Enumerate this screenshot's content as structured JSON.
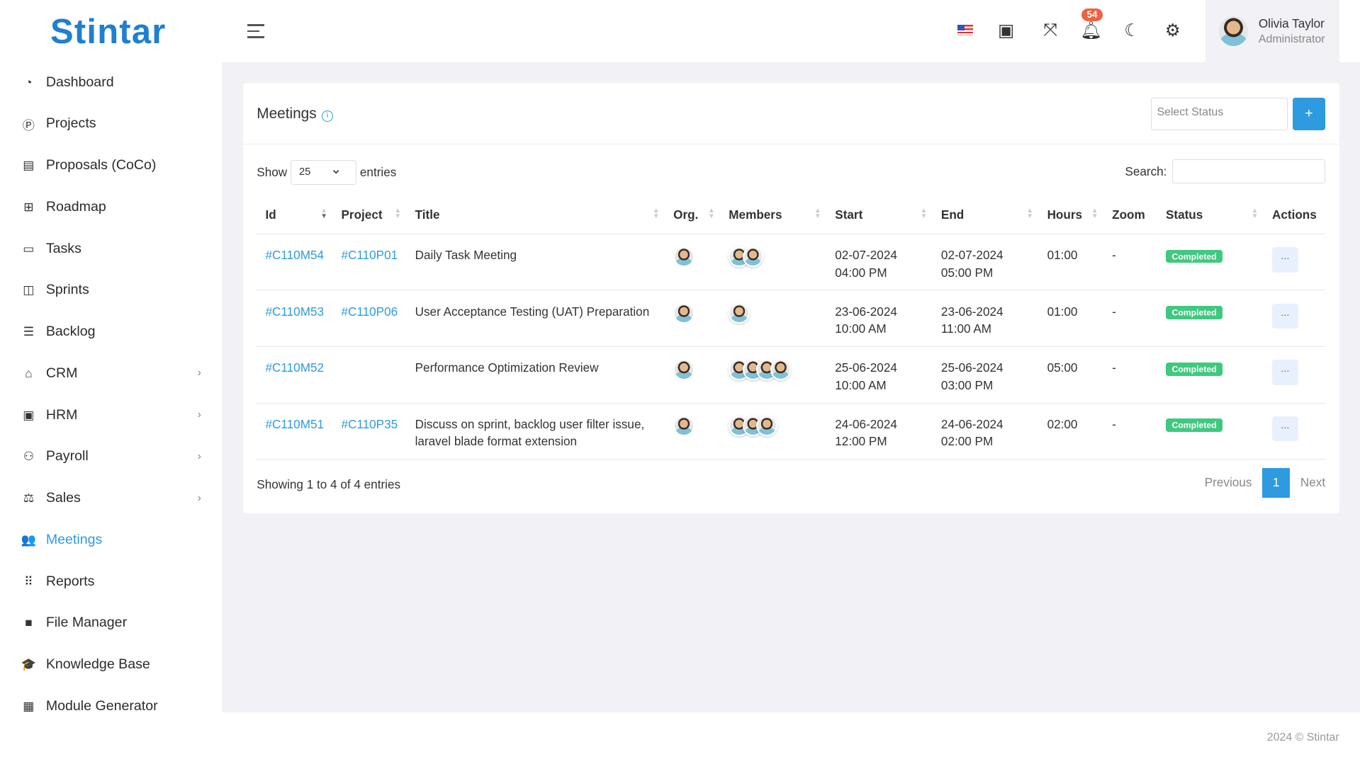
{
  "brand": {
    "logo": "Stintar"
  },
  "sidebar": {
    "items": [
      {
        "label": "Dashboard",
        "icon": "gauge-icon",
        "glyph": "◔"
      },
      {
        "label": "Projects",
        "icon": "p-circle-icon",
        "glyph": "Ⓟ"
      },
      {
        "label": "Proposals (CoCo)",
        "icon": "layout-icon",
        "glyph": "▤"
      },
      {
        "label": "Roadmap",
        "icon": "sitemap-icon",
        "glyph": "⊞"
      },
      {
        "label": "Tasks",
        "icon": "ticket-icon",
        "glyph": "▭"
      },
      {
        "label": "Sprints",
        "icon": "columns-icon",
        "glyph": "◫"
      },
      {
        "label": "Backlog",
        "icon": "list-check-icon",
        "glyph": "☰"
      },
      {
        "label": "CRM",
        "icon": "house-hand-icon",
        "glyph": "⌂",
        "chevron": true
      },
      {
        "label": "HRM",
        "icon": "id-badge-icon",
        "glyph": "▣",
        "chevron": true
      },
      {
        "label": "Payroll",
        "icon": "user-money-icon",
        "glyph": "⚇",
        "chevron": true
      },
      {
        "label": "Sales",
        "icon": "scale-icon",
        "glyph": "⚖",
        "chevron": true
      },
      {
        "label": "Meetings",
        "icon": "people-icon",
        "glyph": "👥",
        "active": true
      },
      {
        "label": "Reports",
        "icon": "scatter-chart-icon",
        "glyph": "⠿"
      },
      {
        "label": "File Manager",
        "icon": "folder-icon",
        "glyph": "■"
      },
      {
        "label": "Knowledge Base",
        "icon": "graduation-cap-icon",
        "glyph": "🎓"
      },
      {
        "label": "Module Generator",
        "icon": "grid-icon",
        "glyph": "▦"
      }
    ]
  },
  "topbar": {
    "notifications": "54",
    "user": {
      "name": "Olivia Taylor",
      "role": "Administrator"
    }
  },
  "card": {
    "title": "Meetings",
    "status_placeholder": "Select Status",
    "add_label": "+",
    "show_label": "Show",
    "page_length": "25",
    "entries_label": "entries",
    "search_label": "Search:",
    "columns": [
      "Id",
      "Project",
      "Title",
      "Org.",
      "Members",
      "Start",
      "End",
      "Hours",
      "Zoom",
      "Status",
      "Actions"
    ],
    "rows": [
      {
        "id": "#C110M54",
        "project": "#C110P01",
        "title": "Daily Task Meeting",
        "members": 2,
        "start_date": "02-07-2024",
        "start_time": "04:00 PM",
        "end_date": "02-07-2024",
        "end_time": "05:00 PM",
        "hours": "01:00",
        "zoom": "-",
        "status": "Completed",
        "action": "..."
      },
      {
        "id": "#C110M53",
        "project": "#C110P06",
        "title": "User Acceptance Testing (UAT) Preparation",
        "members": 1,
        "start_date": "23-06-2024",
        "start_time": "10:00 AM",
        "end_date": "23-06-2024",
        "end_time": "11:00 AM",
        "hours": "01:00",
        "zoom": "-",
        "status": "Completed",
        "action": "..."
      },
      {
        "id": "#C110M52",
        "project": "",
        "title": "Performance Optimization Review",
        "members": 4,
        "start_date": "25-06-2024",
        "start_time": "10:00 AM",
        "end_date": "25-06-2024",
        "end_time": "03:00 PM",
        "hours": "05:00",
        "zoom": "-",
        "status": "Completed",
        "action": "..."
      },
      {
        "id": "#C110M51",
        "project": "#C110P35",
        "title": "Discuss on sprint, backlog user filter issue, laravel blade format extension",
        "members": 3,
        "start_date": "24-06-2024",
        "start_time": "12:00 PM",
        "end_date": "24-06-2024",
        "end_time": "02:00 PM",
        "hours": "02:00",
        "zoom": "-",
        "status": "Completed",
        "action": "..."
      }
    ],
    "info": "Showing 1 to 4 of 4 entries",
    "pager": {
      "prev": "Previous",
      "current": "1",
      "next": "Next"
    }
  },
  "footer": {
    "text": "2024 © Stintar"
  }
}
